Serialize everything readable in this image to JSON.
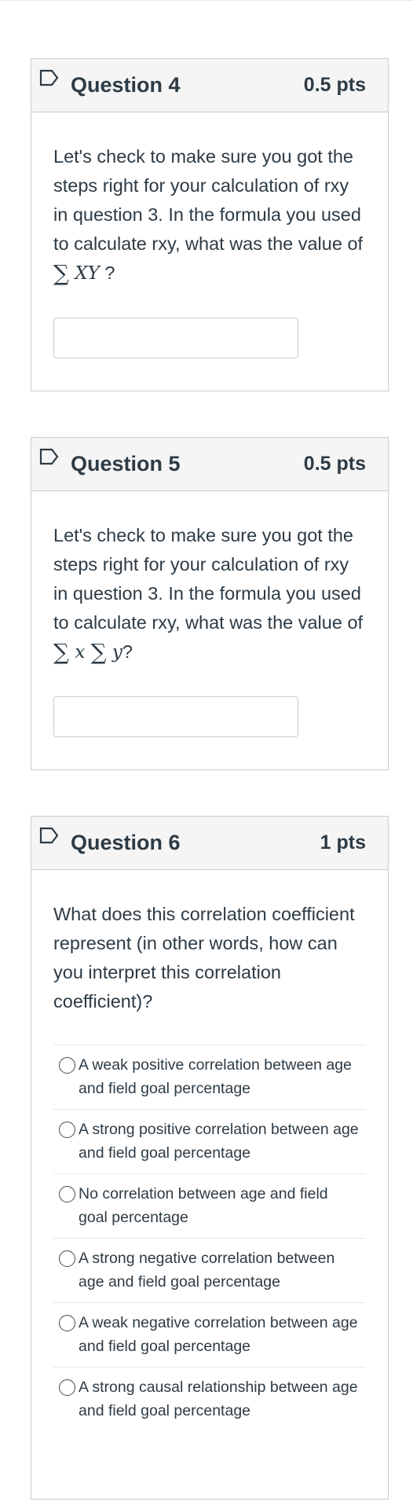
{
  "questions": [
    {
      "title": "Question 4",
      "points": "0.5 pts",
      "prompt_before_math": "Let's check to make sure you got the steps right for your calculation of rxy in question 3. In the formula you used to calculate rxy, what was the value of ",
      "math_sigma": "∑",
      "math_expr": "XY",
      "prompt_after_math": " ?",
      "answer_value": ""
    },
    {
      "title": "Question 5",
      "points": "0.5 pts",
      "prompt_before_math": "Let's check to make sure you got the steps right for your calculation of rxy in question 3. In the formula you used to calculate rxy, what was the value of ",
      "math_sigma": "∑",
      "math_expr1": "x",
      "math_expr2": "y",
      "prompt_after_math": "?",
      "answer_value": ""
    },
    {
      "title": "Question 6",
      "points": "1 pts",
      "prompt": "What does this correlation coefficient represent (in other words, how can you interpret this correlation coefficient)?",
      "choices": [
        "A weak positive correlation between age and field goal percentage",
        "A strong positive correlation between age and field goal percentage",
        "No correlation between age and field goal percentage",
        "A strong negative correlation between age and field goal percentage",
        "A weak negative correlation between age and field goal percentage",
        "A strong causal relationship between age and field goal percentage"
      ]
    }
  ],
  "icons": {
    "flag": "flag-question-icon",
    "radio": "radio-button-icon"
  },
  "colors": {
    "text": "#2d3b45",
    "border": "#c7cdd1",
    "header_bg": "#f5f5f5",
    "flag": "#2d3b45"
  }
}
